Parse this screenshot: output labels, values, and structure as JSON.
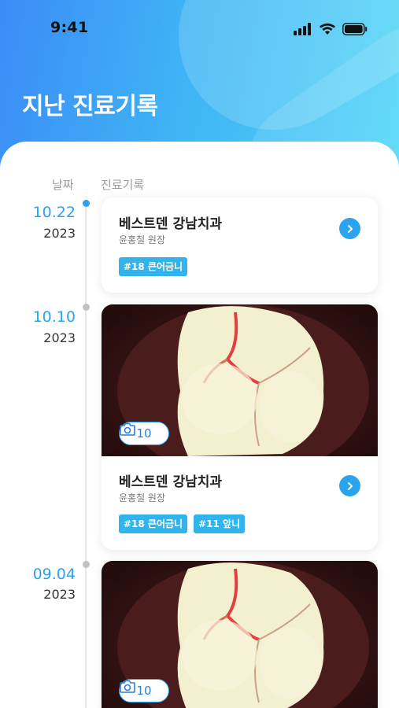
{
  "status": {
    "time": "9:41"
  },
  "header": {
    "title": "지난 진료기록"
  },
  "columns": {
    "date": "날짜",
    "record": "진료기록"
  },
  "records": [
    {
      "day": "10.22",
      "year": "2023",
      "active": true,
      "clinic": "베스트덴 강남치과",
      "doctor": "윤홍철 원장",
      "tags": [
        "#18 큰어금니"
      ],
      "has_photo": false
    },
    {
      "day": "10.10",
      "year": "2023",
      "active": false,
      "clinic": "베스트덴 강남치과",
      "doctor": "윤홍철 원장",
      "tags": [
        "#18 큰어금니",
        "#11 앞니"
      ],
      "has_photo": true,
      "photo_count": "10"
    },
    {
      "day": "09.04",
      "year": "2023",
      "active": false,
      "has_photo": true,
      "photo_count": "10"
    }
  ],
  "colors": {
    "accent": "#2aa4ef",
    "tag": "#31b3ee",
    "active_date": "#2aa4ef",
    "inactive_date": "#2aa4ef"
  }
}
